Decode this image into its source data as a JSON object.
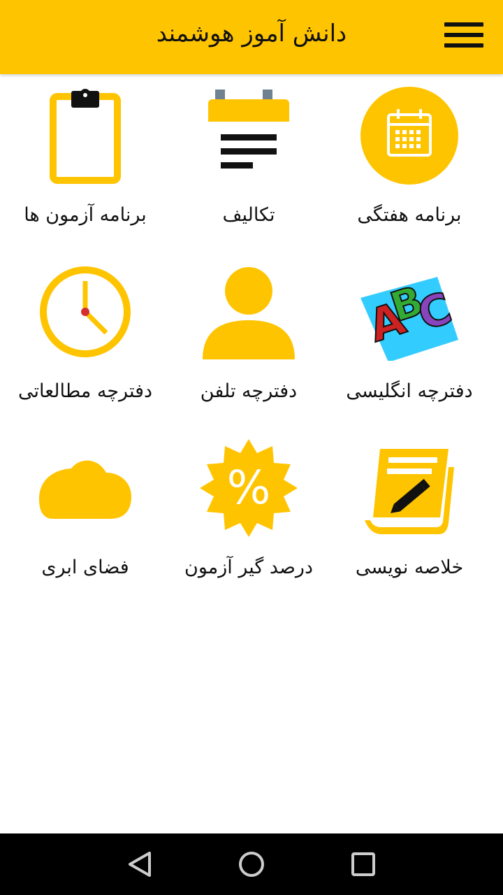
{
  "app_bar": {
    "title": "دانش آموز هوشمند",
    "menu_icon": "hamburger-menu-icon"
  },
  "colors": {
    "accent": "#FFC400",
    "text": "#111111",
    "nav_bar": "#000000"
  },
  "tiles": [
    {
      "label": "برنامه هفتگی",
      "icon": "calendar-icon"
    },
    {
      "label": "تکالیف",
      "icon": "notepad-icon"
    },
    {
      "label": "برنامه آزمون ها",
      "icon": "clipboard-icon"
    },
    {
      "label": "دفترچه انگلیسی",
      "icon": "abc-letters-icon"
    },
    {
      "label": "دفترچه تلفن",
      "icon": "person-icon"
    },
    {
      "label": "دفترچه مطالعاتی",
      "icon": "clock-icon"
    },
    {
      "label": "خلاصه نویسی",
      "icon": "notebook-pencil-icon"
    },
    {
      "label": "درصد گیر آزمون",
      "icon": "percent-badge-icon"
    },
    {
      "label": "فضای ابری",
      "icon": "cloud-icon"
    }
  ],
  "nav": {
    "back_icon": "back-triangle-icon",
    "home_icon": "home-circle-icon",
    "recents_icon": "recents-square-icon"
  }
}
